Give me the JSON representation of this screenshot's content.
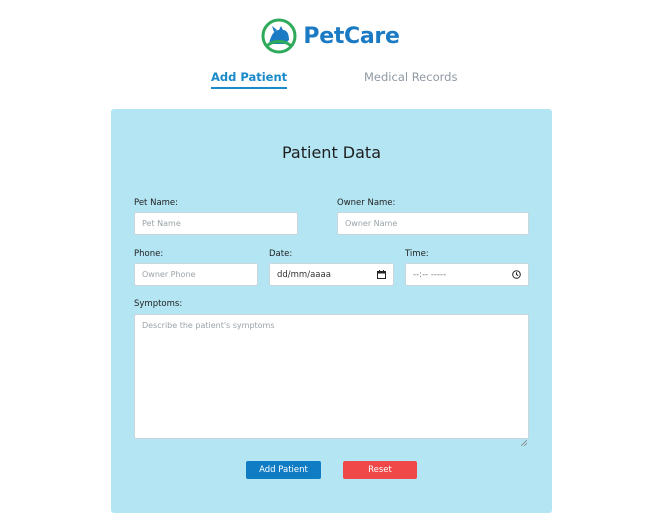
{
  "brand": {
    "name": "PetCare",
    "logo_icon": "pet-logo-icon",
    "color": "#1a7ac4",
    "icon_green": "#2eaa5a"
  },
  "nav": {
    "tabs": [
      {
        "label": "Add Patient",
        "active": true
      },
      {
        "label": "Medical Records",
        "active": false
      }
    ],
    "accent": "#1a8ac8"
  },
  "form": {
    "title": "Patient Data",
    "background": "#b3e5f3",
    "pet_name": {
      "label": "Pet Name:",
      "placeholder": "Pet Name",
      "value": ""
    },
    "owner_name": {
      "label": "Owner Name:",
      "placeholder": "Owner Name",
      "value": ""
    },
    "phone": {
      "label": "Phone:",
      "placeholder": "Owner Phone",
      "value": ""
    },
    "date": {
      "label": "Date:",
      "display": "dd/mm/aaaa",
      "icon": "calendar-icon"
    },
    "time": {
      "label": "Time:",
      "display": "--:-- -----",
      "icon": "clock-icon"
    },
    "symptoms": {
      "label": "Symptoms:",
      "placeholder": "Describe the patient's symptoms",
      "value": ""
    }
  },
  "buttons": {
    "add_label": "Add Patient",
    "add_color": "#0f7cc4",
    "reset_label": "Reset",
    "reset_color": "#f04848"
  }
}
